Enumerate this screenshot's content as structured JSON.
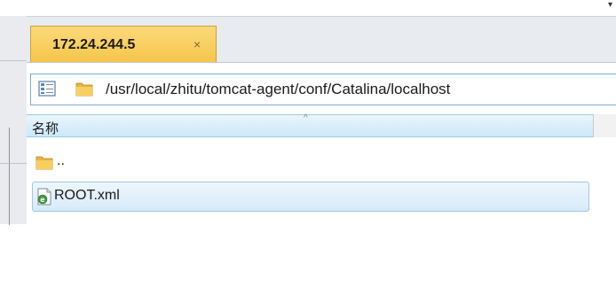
{
  "tab": {
    "label": "172.24.244.5",
    "close_glyph": "×"
  },
  "pathbar": {
    "path": "/usr/local/zhitu/tomcat-agent/conf/Catalina/localhost",
    "view_icon": "view-mode-icon",
    "folder_icon": "folder-icon"
  },
  "columns": {
    "name_header": "名称",
    "sort_glyph": "^"
  },
  "files": [
    {
      "name": "..",
      "icon": "folder-icon",
      "selected": false
    },
    {
      "name": "ROOT.xml",
      "icon": "xml-file-icon",
      "selected": true
    }
  ],
  "top_arrow": "▾",
  "colors": {
    "tab_active": "#f6c54a",
    "selection": "#d6eafa",
    "header_bg": "#cde8f8"
  }
}
